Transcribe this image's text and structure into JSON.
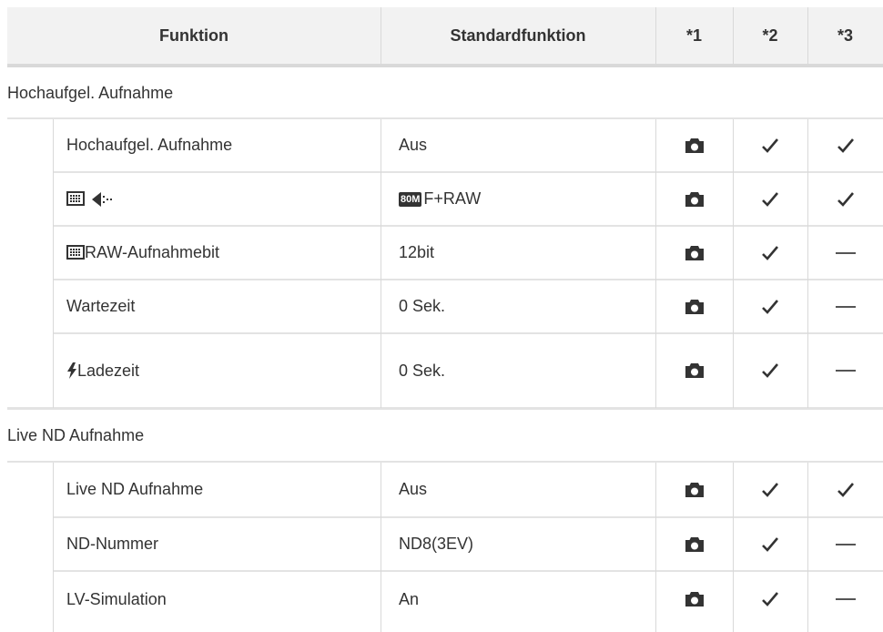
{
  "header": {
    "col_function": "Funktion",
    "col_default": "Standardfunktion",
    "col_1": "*1",
    "col_2": "*2",
    "col_3": "*3"
  },
  "sections": [
    {
      "title": "Hochaufgel. Aufnahme",
      "rows": [
        {
          "function": "Hochaufgel. Aufnahme",
          "default": "Aus",
          "c1": "camera",
          "c2": "check",
          "c3": "check"
        },
        {
          "function_icons": [
            "hires-grid-icon",
            "arrow-dots-icon"
          ],
          "default_badge": "80M",
          "default": "F+RAW",
          "c1": "camera",
          "c2": "check",
          "c3": "check"
        },
        {
          "function_icon": "hires-grid-icon",
          "function": "RAW-Aufnahmebit",
          "default": "12bit",
          "c1": "camera",
          "c2": "check",
          "c3": "dash"
        },
        {
          "function": "Wartezeit",
          "default": "0 Sek.",
          "c1": "camera",
          "c2": "check",
          "c3": "dash"
        },
        {
          "function_icon": "flash-icon",
          "function": "Ladezeit",
          "default": "0 Sek.",
          "c1": "camera",
          "c2": "check",
          "c3": "dash"
        }
      ]
    },
    {
      "title": "Live ND Aufnahme",
      "rows": [
        {
          "function": "Live ND Aufnahme",
          "default": "Aus",
          "c1": "camera",
          "c2": "check",
          "c3": "check"
        },
        {
          "function": "ND-Nummer",
          "default": "ND8(3EV)",
          "c1": "camera",
          "c2": "check",
          "c3": "dash"
        },
        {
          "function": "LV-Simulation",
          "default": "An",
          "c1": "camera",
          "c2": "check",
          "c3": "dash"
        }
      ]
    }
  ],
  "colors": {
    "header_bg": "#f2f2f2",
    "border": "#d9d9d9",
    "text": "#333333"
  }
}
